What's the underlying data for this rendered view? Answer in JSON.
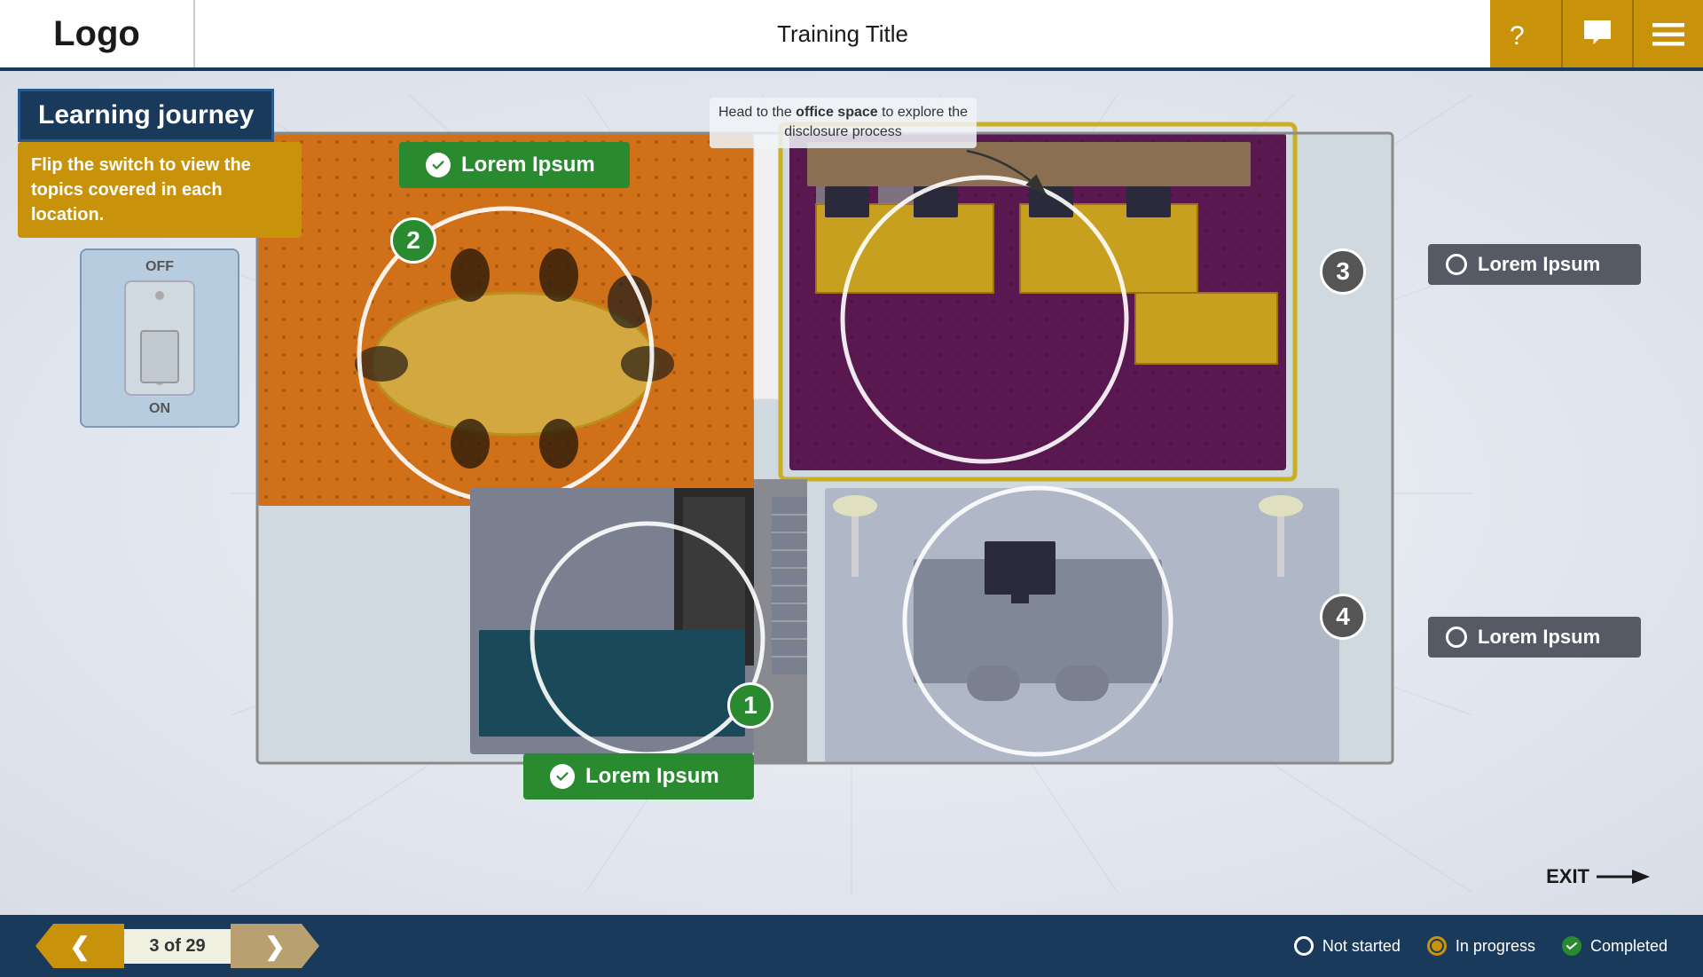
{
  "header": {
    "logo": "Logo",
    "title": "Training Title",
    "buttons": {
      "help_label": "?",
      "chat_label": "💬",
      "menu_label": "☰"
    }
  },
  "sidebar": {
    "title": "Learning journey",
    "instruction": "Flip the switch to view the topics covered in each location.",
    "switch": {
      "off_label": "OFF",
      "on_label": "ON"
    }
  },
  "annotation": {
    "text": "Head to the office space to explore the disclosure process",
    "bold_part": "office space"
  },
  "locations": [
    {
      "id": 1,
      "number": "1",
      "label": "Lorem Ipsum",
      "status": "completed",
      "position": "bottom-center"
    },
    {
      "id": 2,
      "number": "2",
      "label": "Lorem Ipsum",
      "status": "completed",
      "position": "top-left"
    },
    {
      "id": 3,
      "number": "3",
      "label": "Lorem Ipsum",
      "status": "not-started",
      "position": "top-right"
    },
    {
      "id": 4,
      "number": "4",
      "label": "Lorem Ipsum",
      "status": "not-started",
      "position": "bottom-right"
    }
  ],
  "exit": {
    "label": "EXIT"
  },
  "footer": {
    "prev_label": "❮",
    "next_label": "❯",
    "page_current": 3,
    "page_total": 29,
    "page_display": "3 of 29",
    "legend": {
      "not_started": "Not started",
      "in_progress": "In progress",
      "completed": "Completed"
    }
  }
}
